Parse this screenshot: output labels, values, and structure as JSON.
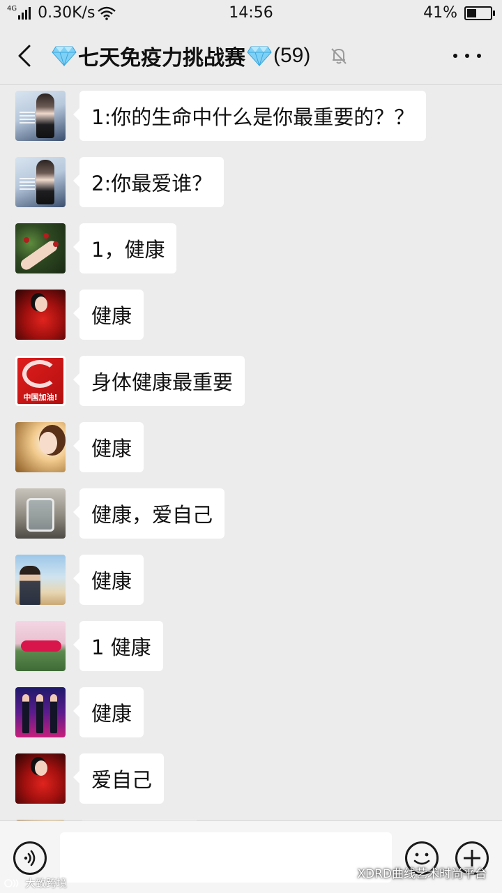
{
  "status_bar": {
    "network": "4G",
    "speed": "0.30K/s",
    "time": "14:56",
    "battery": "41%",
    "battery_level": 0.41
  },
  "header": {
    "title": "七天免疫力挑战赛",
    "member_count": "(59)",
    "muted": true
  },
  "messages": [
    {
      "text": "1:你的生命中什么是你最重要的？？",
      "avatar": "poster-woman-avatar"
    },
    {
      "text": "2:你最爱谁？",
      "avatar": "poster-woman-avatar"
    },
    {
      "text": "1，健康",
      "avatar": "hand-berries-avatar"
    },
    {
      "text": "健康",
      "avatar": "red-dress-woman-avatar"
    },
    {
      "text": "身体健康最重要",
      "avatar": "fu-character-avatar",
      "avatar_caption": "中国加油!"
    },
    {
      "text": "健康",
      "avatar": "golden-portrait-avatar"
    },
    {
      "text": "健康，爱自己",
      "avatar": "glass-cup-avatar"
    },
    {
      "text": "健康",
      "avatar": "beach-man-avatar"
    },
    {
      "text": "1 健康",
      "avatar": "pink-lawn-avatar"
    },
    {
      "text": "健康",
      "avatar": "stage-group-avatar"
    },
    {
      "text": "爱自己",
      "avatar": "red-dress-woman-avatar"
    }
  ],
  "input_bar": {
    "value": "",
    "placeholder": ""
  },
  "watermarks": {
    "left": "大致跨境",
    "right": "XDRD曲线艺术时尚平台"
  },
  "colors": {
    "background": "#ececec",
    "bubble": "#ffffff",
    "input_bar": "#f5f5f5"
  }
}
